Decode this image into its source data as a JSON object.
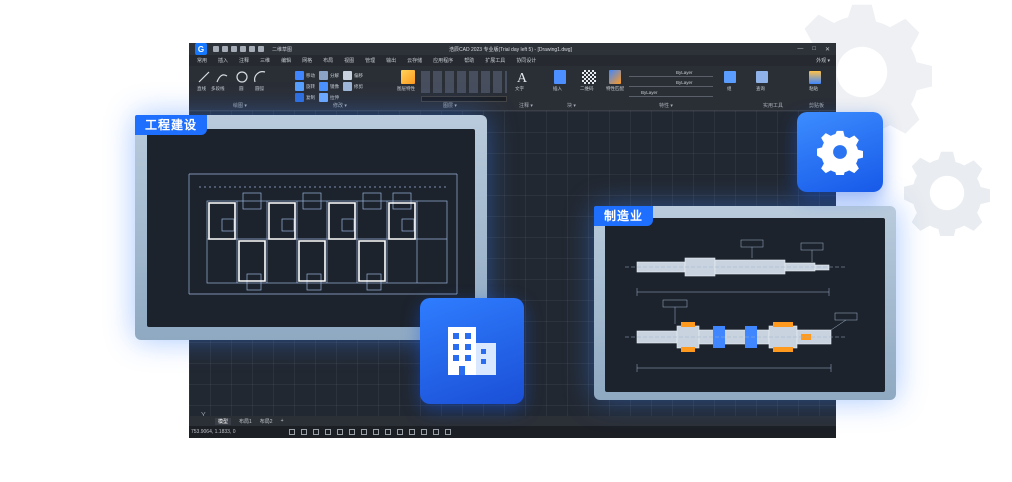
{
  "window": {
    "title": "浩辰CAD 2023 专业版(Trial day left 5) - [Drawing1.dwg]",
    "logo": "G",
    "workspace": "二维草图",
    "controls": [
      "—",
      "□",
      "✕"
    ]
  },
  "menu": {
    "items": [
      "常用",
      "插入",
      "注释",
      "三维",
      "编辑",
      "网格",
      "布局",
      "视图",
      "管理",
      "输出",
      "云存储",
      "应用程序",
      "帮助",
      "扩展工具",
      "协同设计"
    ],
    "right": "外观 ▾"
  },
  "ribbon": {
    "groups": [
      "绘图 ▾",
      "修改 ▾",
      "图层 ▾",
      "注释 ▾",
      "块 ▾",
      "特性 ▾",
      "实用工具",
      "剪贴板"
    ],
    "labels": {
      "line": "直线",
      "polyline": "多段线",
      "circle": "圆",
      "arc": "圆弧",
      "move": "移动",
      "rotate": "旋转",
      "copy": "复制",
      "mirror": "镜像",
      "stretch": "拉伸",
      "trim": "修剪",
      "explode": "分解",
      "offset": "偏移",
      "layer_props": "图层特性",
      "text": "文字",
      "insert": "插入",
      "qrcode": "二维码",
      "match_props": "特性匹配",
      "group": "组",
      "measure": "查询",
      "paste": "粘贴",
      "bylayer": "ByLayer"
    }
  },
  "tabs": {
    "items": [
      "模型",
      "布局1",
      "布局2",
      "+"
    ],
    "active": "模型"
  },
  "status": {
    "coords": "753.9064, 1.1833, 0"
  },
  "cards": {
    "engineering": {
      "label": "工程建设"
    },
    "manufacturing": {
      "label": "制造业"
    }
  },
  "icons": {
    "settings": "gear-icon",
    "building": "building-icon"
  },
  "colors": {
    "accent": "#1f6fff",
    "cad_bg": "#222831",
    "drawing_lines": "#b8d4ff",
    "highlight_orange": "#ff9a1f"
  }
}
